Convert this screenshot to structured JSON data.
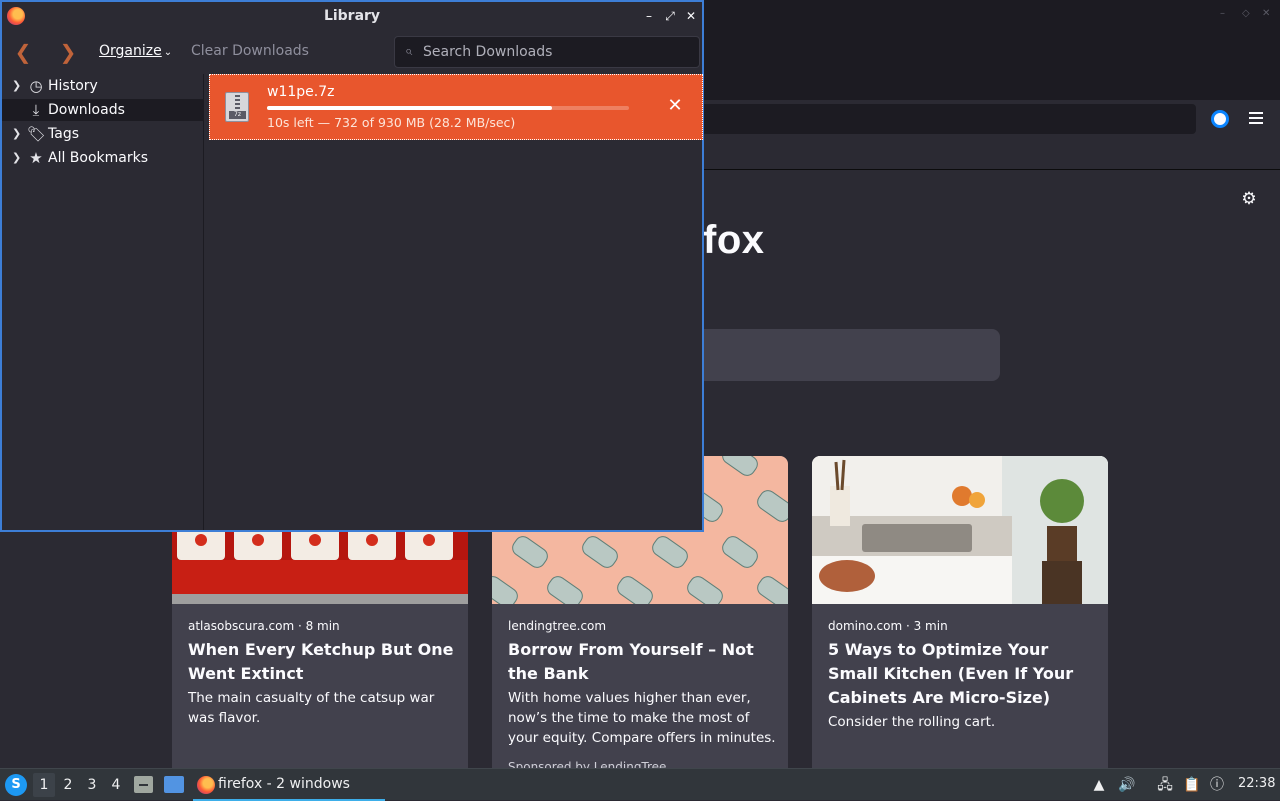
{
  "colors": {
    "accent": "#3d7ed6",
    "download_highlight": "#e8562d",
    "taskbar": "#31363b"
  },
  "background_browser": {
    "wordmark_partial": "fox",
    "cards": [
      {
        "source": "atlasobscura.com · 8 min",
        "title": "When Every Ketchup But One Went Extinct",
        "excerpt": "The main casualty of the catsup war was flavor.",
        "sponsor": ""
      },
      {
        "source": "lendingtree.com",
        "title": "Borrow From Yourself – Not the Bank",
        "excerpt": "With home values higher than ever, now’s the time to make the most of your equity. Compare offers in minutes.",
        "sponsor": "Sponsored by LendingTree"
      },
      {
        "source": "domino.com · 3 min",
        "title": "5 Ways to Optimize Your Small Kitchen (Even If Your Cabinets Are Micro-Size)",
        "excerpt": "Consider the rolling cart.",
        "sponsor": ""
      }
    ]
  },
  "library": {
    "title": "Library",
    "toolbar": {
      "organize_label": "Organize",
      "clear_label": "Clear Downloads",
      "search_placeholder": "Search Downloads"
    },
    "sidebar": {
      "items": [
        {
          "label": "History",
          "icon": "clock-icon",
          "expandable": true,
          "selected": false
        },
        {
          "label": "Downloads",
          "icon": "download-icon",
          "expandable": false,
          "selected": true
        },
        {
          "label": "Tags",
          "icon": "tags-icon",
          "expandable": true,
          "selected": false
        },
        {
          "label": "All Bookmarks",
          "icon": "star-icon",
          "expandable": true,
          "selected": false
        }
      ]
    },
    "download": {
      "filename": "w11pe.7z",
      "status": "10s left — 732 of 930 MB (28.2 MB/sec)",
      "progress_fraction": 0.787
    }
  },
  "taskbar": {
    "workspaces": [
      "1",
      "2",
      "3",
      "4"
    ],
    "active_workspace": "1",
    "task_label": "firefox - 2 windows",
    "clock": "22:38"
  }
}
